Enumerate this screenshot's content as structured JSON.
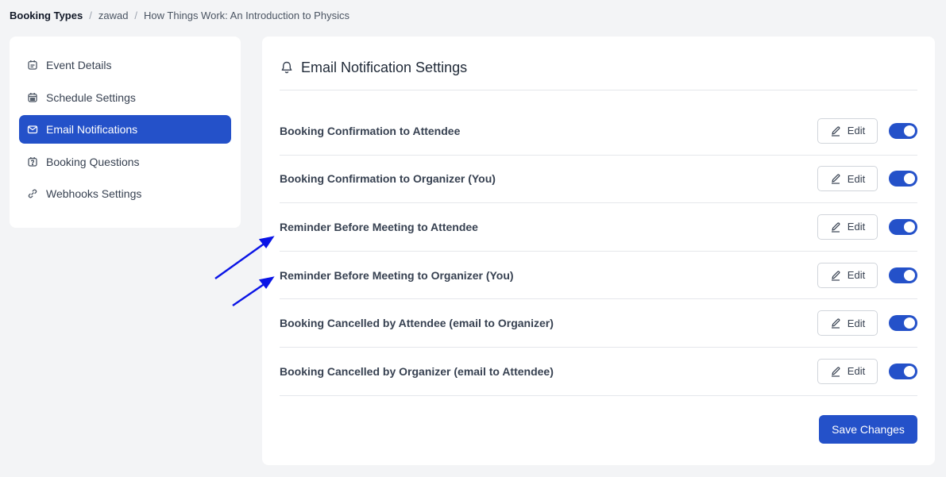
{
  "breadcrumb": {
    "items": [
      "Booking Types",
      "zawad",
      "How Things Work: An Introduction to Physics"
    ],
    "separator": "/"
  },
  "sidebar": {
    "items": [
      {
        "label": "Event Details",
        "icon": "calendar-icon",
        "active": false
      },
      {
        "label": "Schedule Settings",
        "icon": "calendar-grid-icon",
        "active": false
      },
      {
        "label": "Email Notifications",
        "icon": "mail-icon",
        "active": true
      },
      {
        "label": "Booking Questions",
        "icon": "question-calendar-icon",
        "active": false
      },
      {
        "label": "Webhooks Settings",
        "icon": "link-icon",
        "active": false
      }
    ]
  },
  "main": {
    "title": "Email Notification Settings",
    "title_icon": "bell-icon",
    "edit_label": "Edit",
    "save_label": "Save Changes",
    "notifications": [
      {
        "label": "Booking Confirmation to Attendee",
        "enabled": true
      },
      {
        "label": "Booking Confirmation to Organizer (You)",
        "enabled": true
      },
      {
        "label": "Reminder Before Meeting to Attendee",
        "enabled": true
      },
      {
        "label": "Reminder Before Meeting to Organizer (You)",
        "enabled": true
      },
      {
        "label": "Booking Cancelled by Attendee (email to Organizer)",
        "enabled": true
      },
      {
        "label": "Booking Cancelled by Organizer (email to Attendee)",
        "enabled": true
      }
    ]
  },
  "colors": {
    "accent": "#2451c9",
    "background": "#f3f4f6",
    "annotation_arrow": "#0a14e6"
  }
}
